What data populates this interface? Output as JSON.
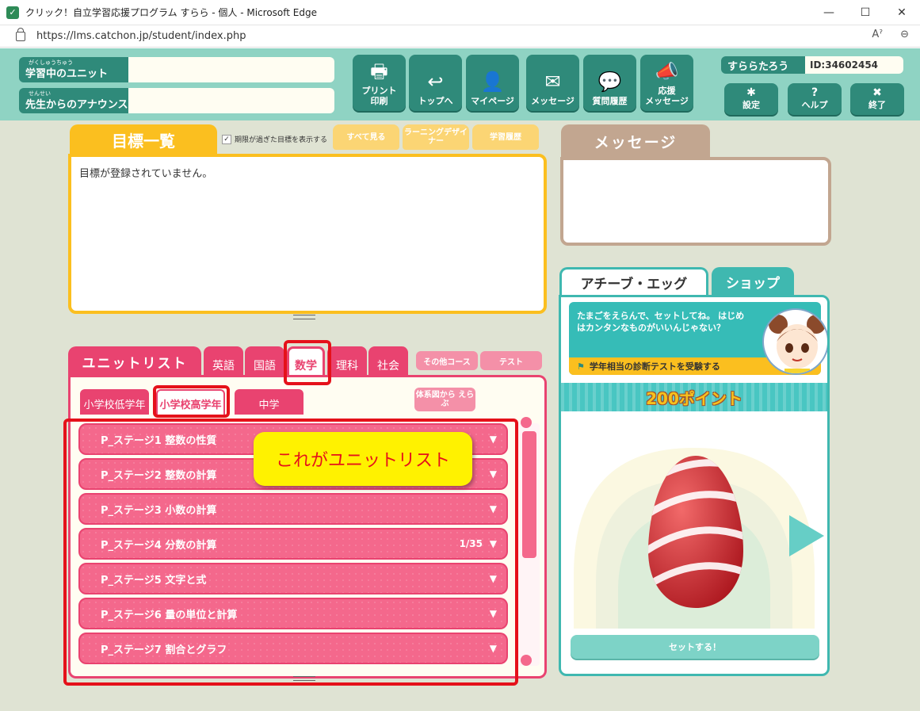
{
  "browser": {
    "title": "クリック！自立学習応援プログラム すらら - 個人 - Microsoft Edge",
    "url": "https://lms.catchon.jp/student/index.php",
    "minimize": "—",
    "maximize": "☐",
    "close": "✕",
    "read_aloud": "Aˀ",
    "zoom": "⊖"
  },
  "header": {
    "current_unit_label": "学習中のユニット",
    "current_unit_ruby": "がくしゅうちゅう",
    "current_unit_value": "",
    "announce_label": "先生からのアナウンス",
    "announce_ruby": "せんせい",
    "announce_value": "",
    "nav": [
      {
        "label": "プリント印刷",
        "line1": "プリント",
        "line2": "印刷",
        "icon": "🖶"
      },
      {
        "label": "トップへ",
        "icon": "↩"
      },
      {
        "label": "マイページ",
        "icon": "👤"
      },
      {
        "label": "メッセージ",
        "icon": "✉"
      },
      {
        "label": "質問履歴",
        "icon": "💬"
      },
      {
        "label": "応援メッセージ",
        "line1": "応援",
        "line2": "メッセージ",
        "icon": "📣"
      }
    ],
    "user_name": "すららたろう",
    "user_id": "ID:34602454",
    "settings": {
      "label": "設定",
      "icon": "✱"
    },
    "help": {
      "label": "ヘルプ",
      "icon": "?"
    },
    "exit": {
      "label": "終了",
      "icon": "✖"
    }
  },
  "goals": {
    "tab_label": "目標一覧",
    "show_expired_label": "期限が過ぎた目標を表示する",
    "checkbox_mark": "✓",
    "buttons": {
      "all": "すべて見る",
      "designer": "ラーニングデザイナー",
      "history": "学習履歴"
    },
    "empty_message": "目標が登録されていません。"
  },
  "unit_list": {
    "tab_label": "ユニットリスト",
    "subjects": [
      {
        "label": "英語",
        "active": false
      },
      {
        "label": "国語",
        "active": false
      },
      {
        "label": "数学",
        "active": true
      },
      {
        "label": "理科",
        "active": false
      },
      {
        "label": "社会",
        "active": false
      }
    ],
    "other_course": "その他コース",
    "test": "テスト",
    "grades": [
      {
        "label": "小学校低学年",
        "active": false
      },
      {
        "label": "小学校高学年",
        "active": true
      },
      {
        "label": "中学",
        "active": false
      }
    ],
    "choose_by_diagram": "体系図から えらぶ",
    "units": [
      {
        "name": "P_ステージ1  整数の性質",
        "count": ""
      },
      {
        "name": "P_ステージ2  整数の計算",
        "count": ""
      },
      {
        "name": "P_ステージ3  小数の計算",
        "count": ""
      },
      {
        "name": "P_ステージ4  分数の計算",
        "count": "1/35"
      },
      {
        "name": "P_ステージ5  文字と式",
        "count": ""
      },
      {
        "name": "P_ステージ6  量の単位と計算",
        "count": ""
      },
      {
        "name": "P_ステージ7  割合とグラフ",
        "count": ""
      }
    ],
    "dropdown_arrow": "▼",
    "callout": "これがユニットリスト"
  },
  "message_panel": {
    "tab_label": "メッセージ"
  },
  "achieve": {
    "tab_label": "アチーブ・エッグ",
    "shop_label": "ショップ",
    "banner_text": "たまごをえらんで、セットしてね。 はじめはカンタンなものがいいんじゃない？",
    "flag_icon": "⚑",
    "diagnostic_text": "学年相当の診断テストを受験する",
    "points": "200ポイント",
    "set_button": "セットする！"
  },
  "colors": {
    "header": "#8fd3c3",
    "teal_button": "#2f8a7a",
    "goal_yellow": "#fbbf1f",
    "unit_pink": "#e94370",
    "message_tan": "#c2a690",
    "achieve_teal": "#3fb8b0",
    "annotation_red": "#e5111a"
  }
}
